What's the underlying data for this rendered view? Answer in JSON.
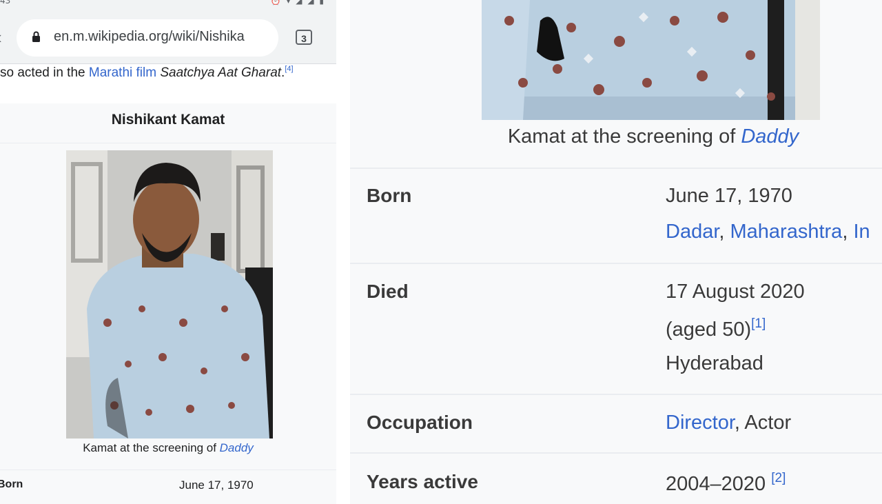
{
  "status": {
    "time": "43"
  },
  "browser": {
    "url": "en.m.wikipedia.org/wiki/Nishika",
    "tab_count": "3"
  },
  "intro": {
    "prefix": "so acted in the ",
    "link1": "Marathi",
    "link2": "film",
    "title": "Saatchya Aat Gharat",
    "end": ".",
    "ref": "[4]"
  },
  "infobox": {
    "title": "Nishikant Kamat",
    "caption_prefix": "Kamat at the screening of ",
    "caption_link": "Daddy",
    "born_label_partial": "Born",
    "born_value": "June 17, 1970"
  },
  "zoom": {
    "caption_prefix": "Kamat at the screening of ",
    "caption_link": "Daddy",
    "born_label": "Born",
    "born_date": "June 17, 1970",
    "born_place_1": "Dadar",
    "born_place_2": "Maharashtra",
    "born_place_3": "In",
    "died_label": "Died",
    "died_date": "17 August 2020",
    "died_age": "(aged 50)",
    "died_ref": "[1]",
    "died_place": "Hyderabad",
    "occupation_label": "Occupation",
    "occupation_link": "Director",
    "occupation_rest": ", Actor",
    "years_label": "Years active",
    "years_value": "2004–2020",
    "years_ref": "[2]"
  }
}
